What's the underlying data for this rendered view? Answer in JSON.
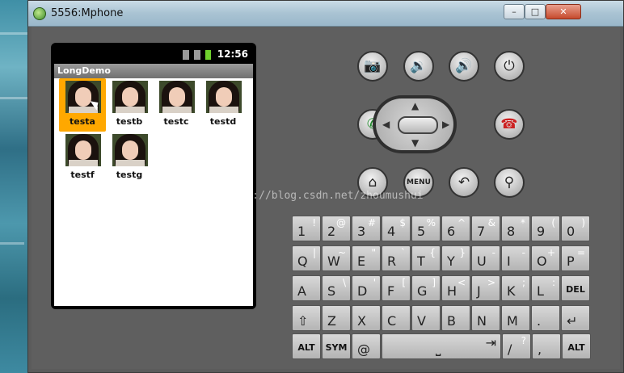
{
  "window": {
    "title": "5556:Mphone",
    "minimize": "–",
    "maximize": "□",
    "close": "✕"
  },
  "phone": {
    "status_time": "12:56",
    "app_title": "LongDemo",
    "grid": [
      {
        "label": "testa",
        "selected": true
      },
      {
        "label": "testb",
        "selected": false
      },
      {
        "label": "testc",
        "selected": false
      },
      {
        "label": "testd",
        "selected": false
      },
      {
        "label": "testf",
        "selected": false
      },
      {
        "label": "testg",
        "selected": false
      }
    ]
  },
  "controls": {
    "camera": "📷",
    "vol_down": "🔉",
    "vol_up": "🔊",
    "power": "⏻",
    "call": "✆",
    "end": "☎",
    "home": "⌂",
    "menu": "MENU",
    "back": "↶",
    "search": "⚲"
  },
  "watermark": "http://blog.csdn.net/zhoumushui",
  "keyboard": {
    "row1": [
      [
        "1",
        "!"
      ],
      [
        "2",
        "@"
      ],
      [
        "3",
        "#"
      ],
      [
        "4",
        "$"
      ],
      [
        "5",
        "%"
      ],
      [
        "6",
        "^"
      ],
      [
        "7",
        "&"
      ],
      [
        "8",
        "*"
      ],
      [
        "9",
        "("
      ],
      [
        "0",
        ")"
      ]
    ],
    "row2": [
      [
        "Q",
        "|"
      ],
      [
        "W",
        "~"
      ],
      [
        "E",
        "\""
      ],
      [
        "R",
        "`"
      ],
      [
        "T",
        "{"
      ],
      [
        "Y",
        "}"
      ],
      [
        "U",
        "-"
      ],
      [
        "I",
        "-"
      ],
      [
        "O",
        "+"
      ],
      [
        "P",
        "="
      ]
    ],
    "row3": [
      [
        "A",
        ""
      ],
      [
        "S",
        "\\"
      ],
      [
        "D",
        "'"
      ],
      [
        "F",
        "["
      ],
      [
        "G",
        "]"
      ],
      [
        "H",
        "<"
      ],
      [
        "J",
        ">"
      ],
      [
        "K",
        ";"
      ],
      [
        "L",
        ":"
      ],
      [
        "DEL",
        ""
      ]
    ],
    "row4": [
      [
        "⇧",
        ""
      ],
      [
        "Z",
        ""
      ],
      [
        "X",
        ""
      ],
      [
        "C",
        ""
      ],
      [
        "V",
        ""
      ],
      [
        "B",
        ""
      ],
      [
        "N",
        ""
      ],
      [
        "M",
        ""
      ],
      [
        ".",
        ""
      ],
      [
        "↵",
        ""
      ]
    ],
    "row5": {
      "alt_left": "ALT",
      "sym": "SYM",
      "at": "@",
      "space": "⎵",
      "tab": "⇥",
      "slash": "/",
      "question": "?",
      "comma": ",",
      "alt_right": "ALT"
    }
  }
}
